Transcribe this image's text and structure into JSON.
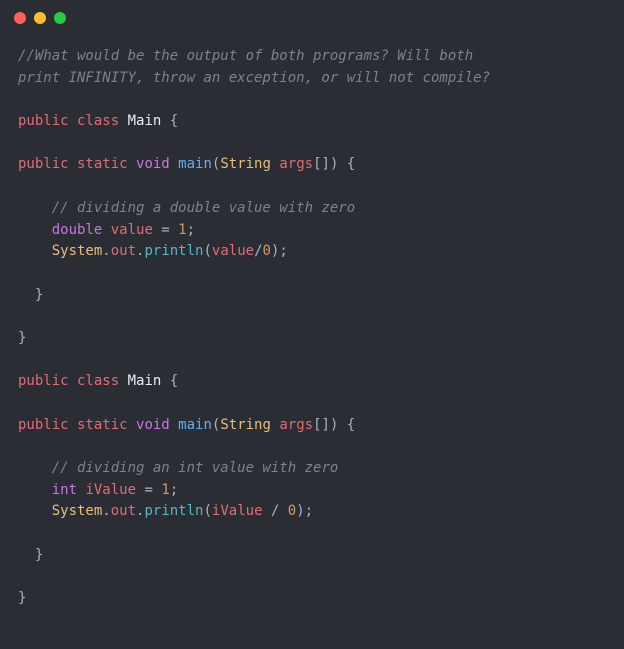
{
  "titlebar": {
    "icons": [
      "close",
      "minimize",
      "maximize"
    ]
  },
  "code": {
    "line1a": "//What would be the output of both programs? Will both",
    "line1b": "print INFINITY, throw an exception, or will not compile?",
    "blank1": "",
    "line2_public": "public",
    "line2_class": " class",
    "line2_name": " Main",
    "line2_brace": " {",
    "blank2": "",
    "line3_public": "public",
    "line3_static": " static",
    "line3_void": " void",
    "line3_main": " main",
    "line3_paren_open": "(",
    "line3_string": "String",
    "line3_args": " args",
    "line3_brackets": "[]",
    "line3_close": ") {",
    "blank3": "",
    "line4_indent": "    ",
    "line4_comment": "// dividing a double value with zero",
    "line5_indent": "    ",
    "line5_double": "double",
    "line5_value": " value",
    "line5_eq": " = ",
    "line5_num": "1",
    "line5_semi": ";",
    "line6_indent": "    ",
    "line6_system": "System",
    "line6_dot1": ".",
    "line6_out": "out",
    "line6_dot2": ".",
    "line6_println": "println",
    "line6_paren_open": "(",
    "line6_value": "value",
    "line6_slash": "/",
    "line6_zero": "0",
    "line6_close": ");",
    "blank4": "",
    "line7_indent": "  ",
    "line7_brace": "}",
    "blank5": "",
    "line8_brace": "}",
    "blank6": "",
    "line9_public": "public",
    "line9_class": " class",
    "line9_name": " Main",
    "line9_brace": " {",
    "blank7": "",
    "line10_public": "public",
    "line10_static": " static",
    "line10_void": " void",
    "line10_main": " main",
    "line10_paren_open": "(",
    "line10_string": "String",
    "line10_args": " args",
    "line10_brackets": "[]",
    "line10_close": ") {",
    "blank8": "",
    "line11_indent": "    ",
    "line11_comment": "// dividing an int value with zero",
    "line12_indent": "    ",
    "line12_int": "int",
    "line12_ivalue": " iValue",
    "line12_eq": " = ",
    "line12_num": "1",
    "line12_semi": ";",
    "line13_indent": "    ",
    "line13_system": "System",
    "line13_dot1": ".",
    "line13_out": "out",
    "line13_dot2": ".",
    "line13_println": "println",
    "line13_paren_open": "(",
    "line13_ivalue": "iValue",
    "line13_slash": " / ",
    "line13_zero": "0",
    "line13_close": ");",
    "blank9": "",
    "line14_indent": "  ",
    "line14_brace": "}",
    "blank10": "",
    "line15_brace": "}"
  }
}
